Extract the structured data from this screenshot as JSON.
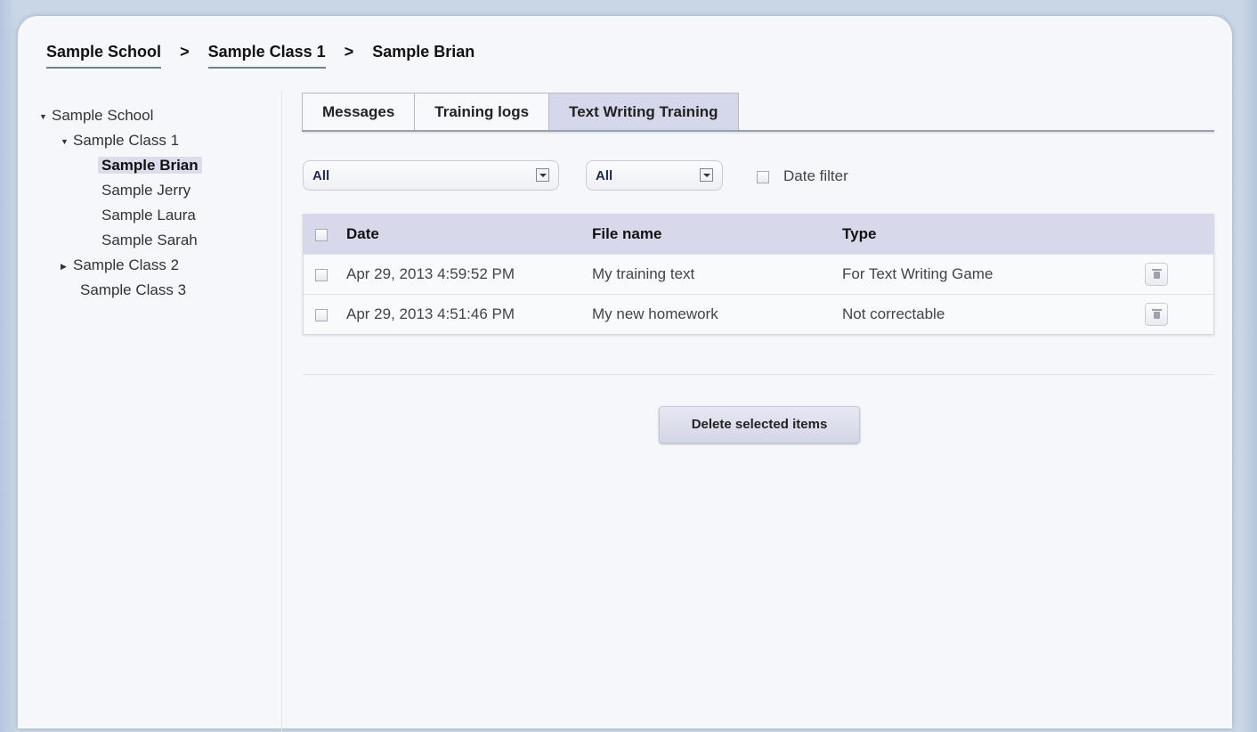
{
  "breadcrumb": {
    "items": [
      "Sample School",
      "Sample Class 1"
    ],
    "separator": ">",
    "current": "Sample Brian"
  },
  "tree": {
    "school": "Sample School",
    "class1": "Sample Class 1",
    "students": [
      "Sample Brian",
      "Sample Jerry",
      "Sample Laura",
      "Sample Sarah"
    ],
    "class2": "Sample Class 2",
    "class3": "Sample Class 3",
    "selected": "Sample Brian"
  },
  "tabs": [
    {
      "label": "Messages",
      "active": false
    },
    {
      "label": "Training logs",
      "active": false
    },
    {
      "label": "Text Writing Training",
      "active": true
    }
  ],
  "filters": {
    "select1_value": "All",
    "select2_value": "All",
    "date_filter_label": "Date filter",
    "date_filter_checked": false
  },
  "table": {
    "columns": {
      "date": "Date",
      "file": "File name",
      "type": "Type"
    },
    "rows": [
      {
        "date": "Apr 29, 2013 4:59:52 PM",
        "file": "My training text",
        "type": "For Text Writing Game"
      },
      {
        "date": "Apr 29, 2013 4:51:46 PM",
        "file": "My new homework",
        "type": "Not correctable"
      }
    ]
  },
  "actions": {
    "delete_selected": "Delete selected items"
  },
  "colors": {
    "background": "#c9d6e6",
    "panel": "#f6f7fb",
    "header_row": "#d7d9ea",
    "active_tab": "#d5d8ea",
    "selected_item": "#dcdcec"
  },
  "icons": {
    "expanded": "triangle-down-icon",
    "collapsed": "triangle-right-icon",
    "row_delete": "trash-icon",
    "dropdown": "chevron-down-icon"
  }
}
